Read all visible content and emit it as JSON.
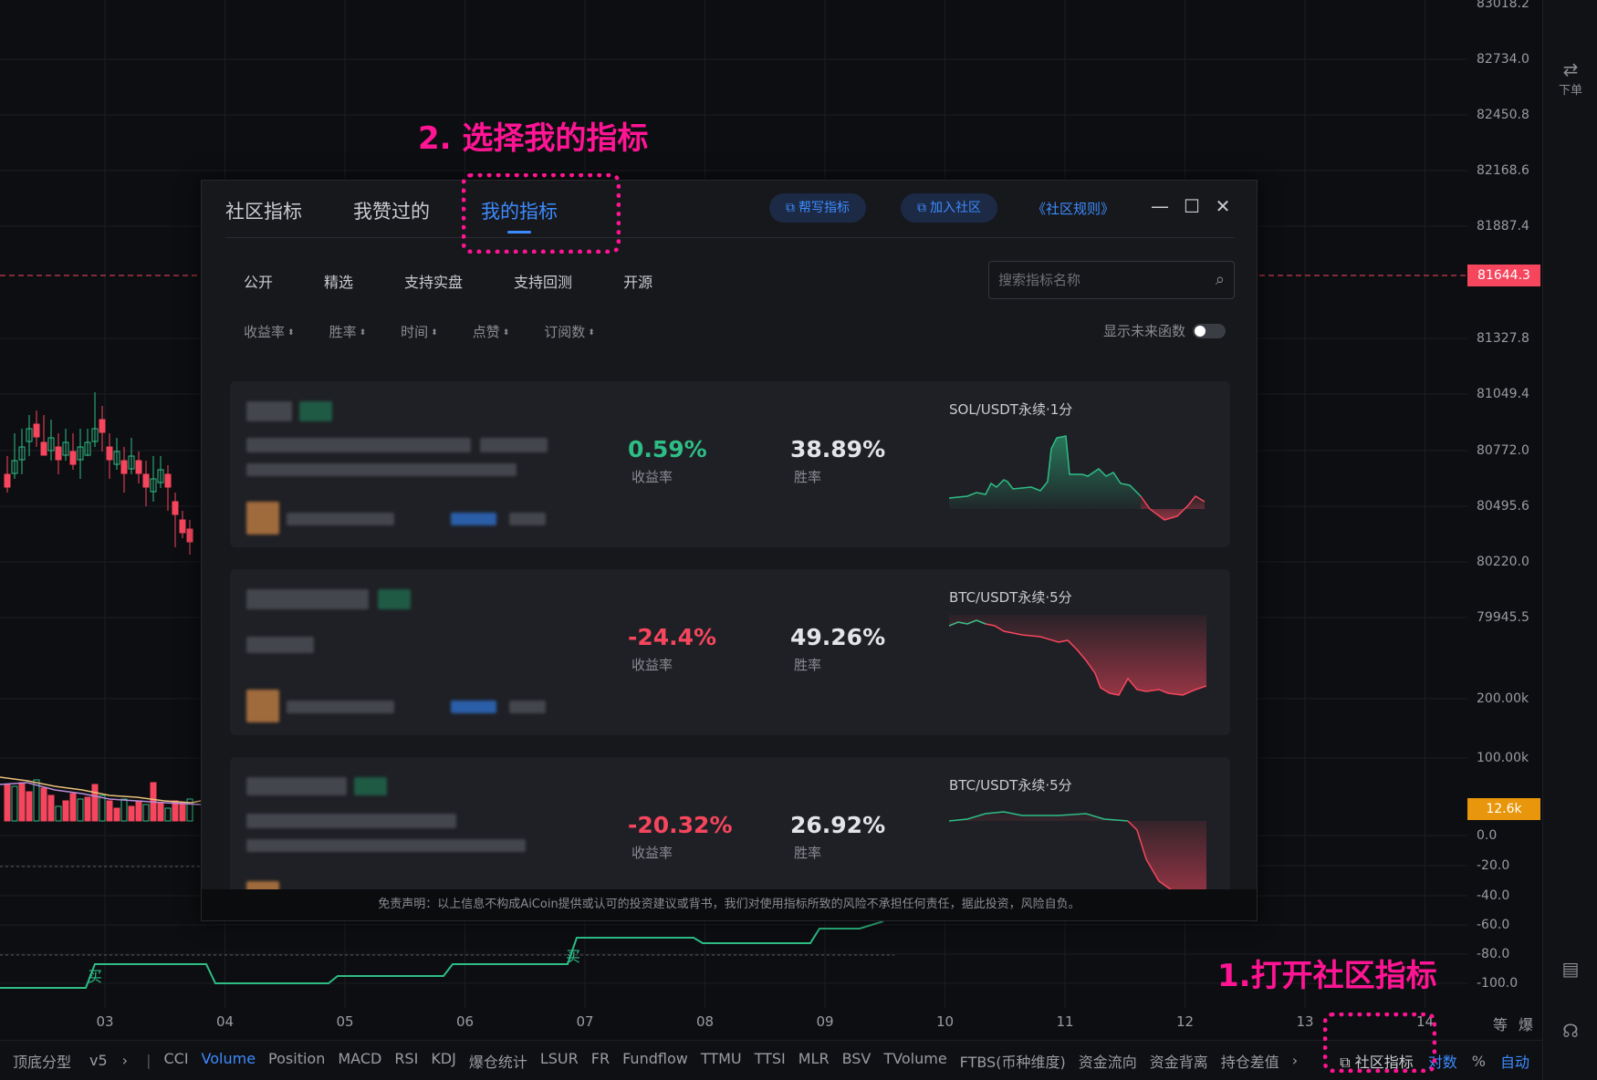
{
  "price_axis": {
    "labels": [
      "83018.2",
      "82734.0",
      "82450.8",
      "82168.6",
      "81887.4",
      "81327.8",
      "81049.4",
      "80772.0",
      "80495.6",
      "80220.0",
      "79945.5",
      "200.00k",
      "100.00k",
      "0.0",
      "-20.0",
      "-40.0",
      "-60.0",
      "-80.0",
      "-100.0"
    ],
    "current_price": "81644.3",
    "volume_badge": "12.6k",
    "current_color": "#f6465d",
    "volume_color": "#e8960c"
  },
  "right_tools": {
    "order_label": "下单"
  },
  "date_axis": [
    "03",
    "04",
    "05",
    "06",
    "07",
    "08",
    "09",
    "10",
    "11",
    "12",
    "13",
    "14"
  ],
  "bottom_bar": {
    "left": [
      "顶底分型",
      "v5"
    ],
    "indicators": [
      "CCI",
      "Volume",
      "Position",
      "MACD",
      "RSI",
      "KDJ",
      "爆仓统计",
      "LSUR",
      "FR",
      "Fundflow",
      "TTMU",
      "TTSI",
      "MLR",
      "BSV",
      "TVolume",
      "FTBS(币种维度)",
      "资金流向",
      "资金背离",
      "持仓差值"
    ],
    "active_indicator": "Volume",
    "community_label": "社区指标",
    "right": [
      "对数",
      "%",
      "自动"
    ],
    "axis_right": [
      "等",
      "爆"
    ]
  },
  "annotations": {
    "step1": "1.打开社区指标",
    "step2": "2. 选择我的指标",
    "color": "#ff1493"
  },
  "dialog": {
    "tabs": [
      "社区指标",
      "我赞过的",
      "我的指标"
    ],
    "active_tab": "我的指标",
    "help_write": "帮写指标",
    "join_community": "加入社区",
    "rules": "《社区规则》",
    "filters": [
      "公开",
      "精选",
      "支持实盘",
      "支持回测",
      "开源"
    ],
    "search_placeholder": "搜索指标名称",
    "sorts": [
      "收益率",
      "胜率",
      "时间",
      "点赞",
      "订阅数"
    ],
    "future_toggle_label": "显示未来函数",
    "future_toggle_on": false,
    "return_caption": "收益率",
    "winrate_caption": "胜率",
    "cards": [
      {
        "return": "0.59%",
        "return_sign": "pos",
        "winrate": "38.89%",
        "pair": "SOL/USDT永续·1分"
      },
      {
        "return": "-24.4%",
        "return_sign": "neg",
        "winrate": "49.26%",
        "pair": "BTC/USDT永续·5分"
      },
      {
        "return": "-20.32%",
        "return_sign": "neg",
        "winrate": "26.92%",
        "pair": "BTC/USDT永续·5分"
      }
    ],
    "disclaimer": "免责声明：以上信息不构成AiCoin提供或认可的投资建议或背书，我们对使用指标所致的风险不承担任何责任，据此投资，风险自负。"
  },
  "chart_labels": {
    "buy_1": "买",
    "buy_2": "买"
  },
  "colors": {
    "up": "#2ebd85",
    "down": "#f6465d",
    "accent": "#3d8bff"
  }
}
